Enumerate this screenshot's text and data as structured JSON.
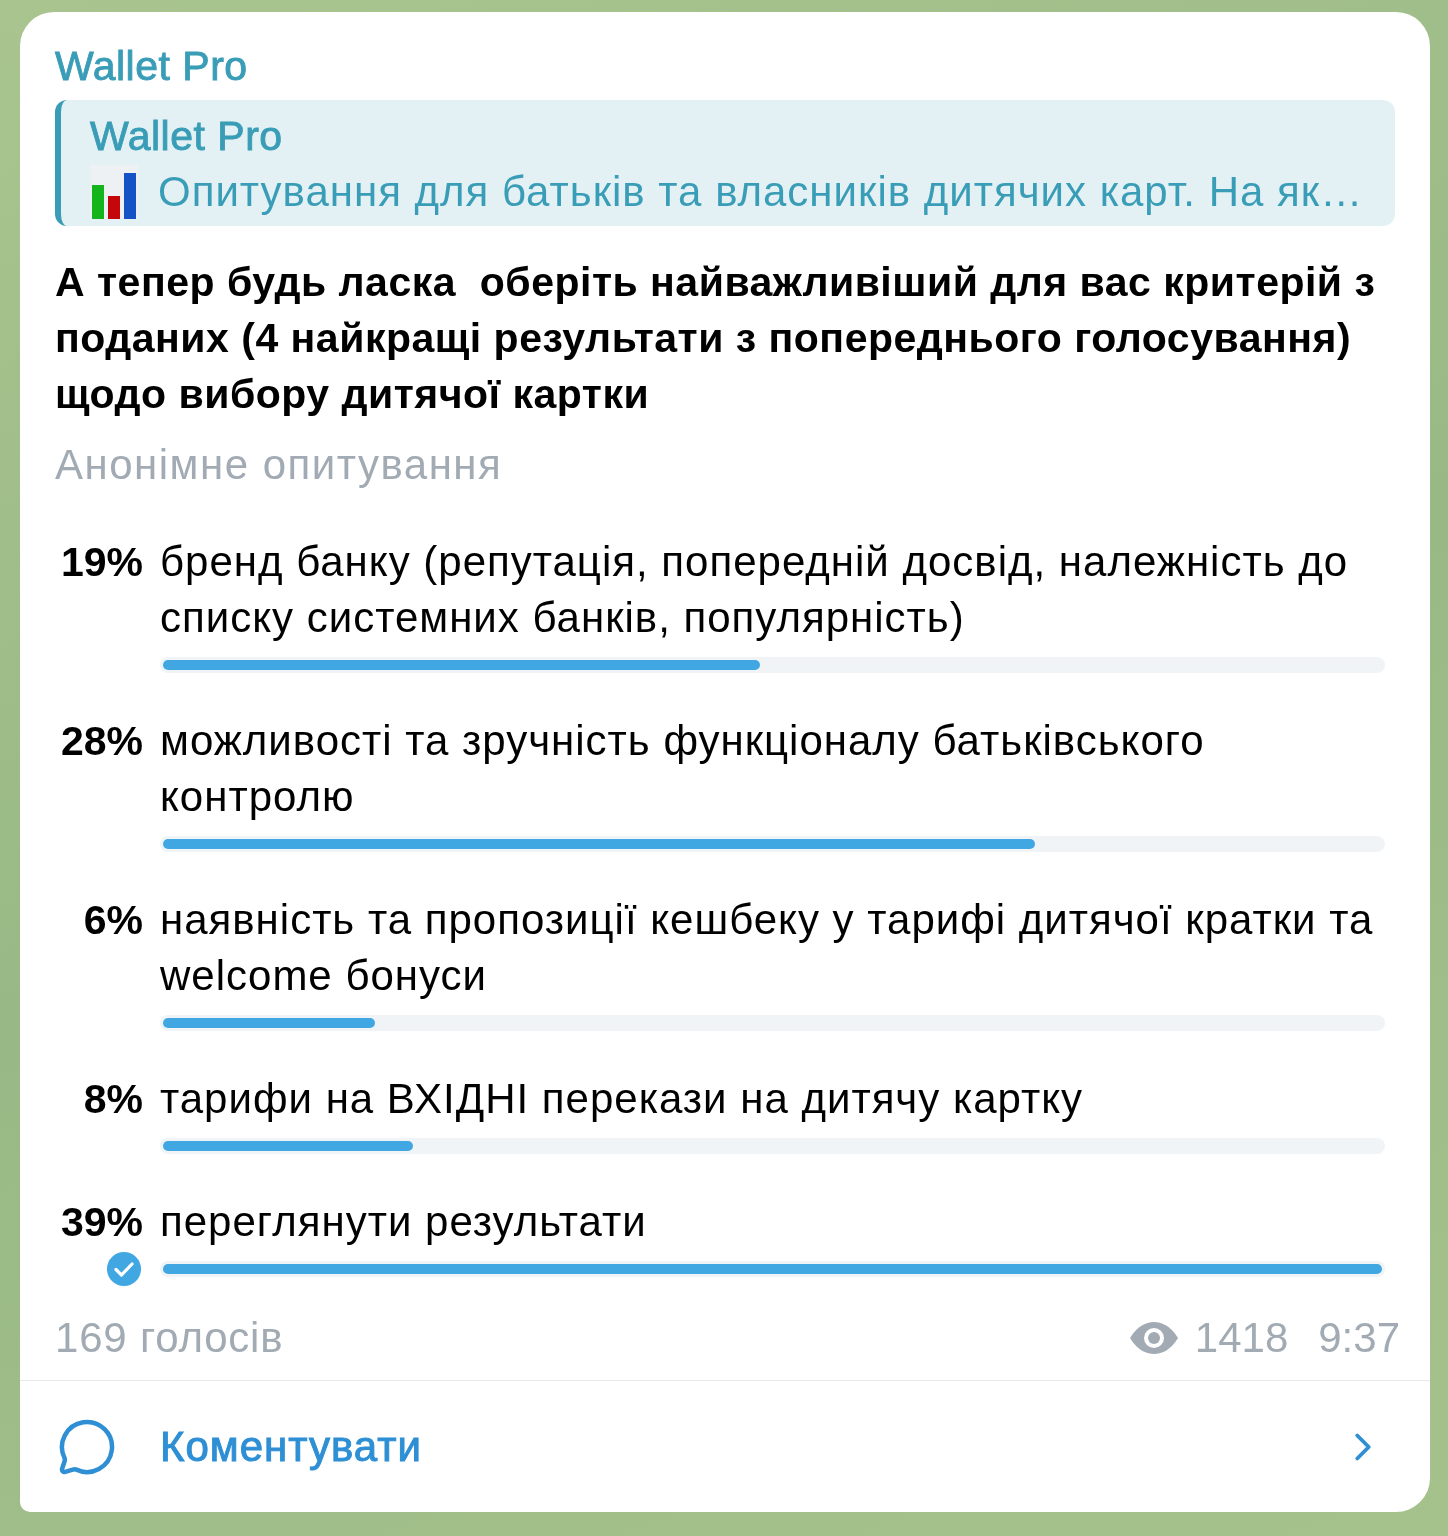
{
  "message": {
    "author": "Wallet Pro",
    "reply": {
      "author": "Wallet Pro",
      "text": "Опитування для батьків та власників дитячих карт. На як…"
    },
    "question": "А тепер будь ласка  оберіть найважливіший для вас критерій з поданих (4 найкращі результати з попереднього голосування) щодо вибору дитячої картки",
    "poll_type": "Анонімне опитування",
    "options": [
      {
        "percent": "19%",
        "text": "бренд банку (репутація, попередній досвід, належність до списку системних банків, популярність)",
        "level": 0.49,
        "selected": false
      },
      {
        "percent": "28%",
        "text": "можливості та зручність функціоналу батьківського контролю",
        "level": 0.715,
        "selected": false
      },
      {
        "percent": "6%",
        "text": "наявність та пропозиції кешбеку у тарифі дитячої кратки та welcome бонуси",
        "level": 0.174,
        "selected": false
      },
      {
        "percent": "8%",
        "text": "тарифи на ВХІДНІ перекази на дитячу картку",
        "level": 0.205,
        "selected": false
      },
      {
        "percent": "39%",
        "text": "переглянути результати",
        "level": 1.0,
        "selected": true
      }
    ],
    "votes": "169 голосів",
    "views": "1418",
    "time": "9:37"
  },
  "comment_button": {
    "label": "Коментувати"
  }
}
